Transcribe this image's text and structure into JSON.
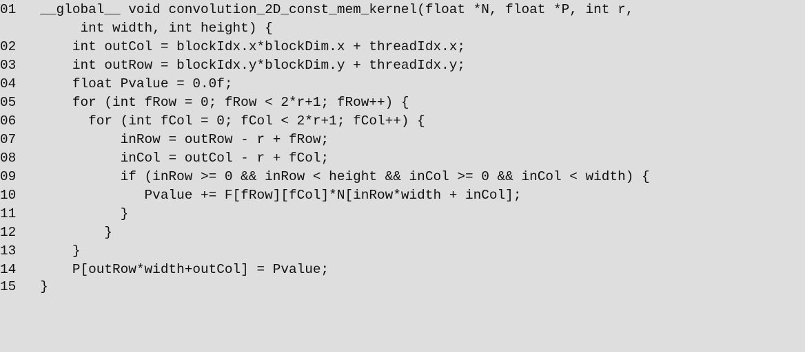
{
  "code": {
    "lines": [
      {
        "number": "01",
        "text": "  __global__ void convolution_2D_const_mem_kernel(float *N, float *P, int r,"
      },
      {
        "number": "",
        "text": "       int width, int height) {"
      },
      {
        "number": "02",
        "text": "      int outCol = blockIdx.x*blockDim.x + threadIdx.x;"
      },
      {
        "number": "03",
        "text": "      int outRow = blockIdx.y*blockDim.y + threadIdx.y;"
      },
      {
        "number": "04",
        "text": "      float Pvalue = 0.0f;"
      },
      {
        "number": "05",
        "text": "      for (int fRow = 0; fRow < 2*r+1; fRow++) {"
      },
      {
        "number": "06",
        "text": "        for (int fCol = 0; fCol < 2*r+1; fCol++) {"
      },
      {
        "number": "07",
        "text": "            inRow = outRow - r + fRow;"
      },
      {
        "number": "08",
        "text": "            inCol = outCol - r + fCol;"
      },
      {
        "number": "09",
        "text": "            if (inRow >= 0 && inRow < height && inCol >= 0 && inCol < width) {"
      },
      {
        "number": "10",
        "text": "               Pvalue += F[fRow][fCol]*N[inRow*width + inCol];"
      },
      {
        "number": "11",
        "text": "            }"
      },
      {
        "number": "12",
        "text": "          }"
      },
      {
        "number": "13",
        "text": "      }"
      },
      {
        "number": "14",
        "text": "      P[outRow*width+outCol] = Pvalue;"
      },
      {
        "number": "15",
        "text": "  }"
      }
    ]
  }
}
